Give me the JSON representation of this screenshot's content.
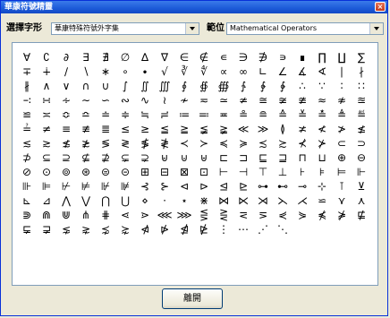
{
  "window": {
    "title": "華康符號精靈",
    "close_glyph": "×"
  },
  "toolbar": {
    "font_label": "選擇字形",
    "font_value": "華康特殊符號外字集",
    "location_label": "範位",
    "location_value": "Mathematical Operators"
  },
  "grid": {
    "rows": [
      [
        "∀",
        "∁",
        "∂",
        "∃",
        "∄",
        "∅",
        "∆",
        "∇",
        "∈",
        "∉",
        "∊",
        "∋",
        "∌",
        "∍",
        "∎",
        "∏",
        "∐",
        "∑",
        "−"
      ],
      [
        "∓",
        "∔",
        "∕",
        "∖",
        "∗",
        "∘",
        "∙",
        "√",
        "∛",
        "∜",
        "∝",
        "∞",
        "∟",
        "∠",
        "∡",
        "∢",
        "∣",
        "∤",
        "∥"
      ],
      [
        "∦",
        "∧",
        "∨",
        "∩",
        "∪",
        "∫",
        "∬",
        "∭",
        "∮",
        "∯",
        "∰",
        "∱",
        "∲",
        "∳",
        "∴",
        "∵",
        "∶",
        "∷",
        "∸"
      ],
      [
        "∹",
        "∺",
        "∻",
        "∼",
        "∽",
        "∾",
        "∿",
        "≀",
        "≁",
        "≂",
        "≃",
        "≄",
        "≅",
        "≆",
        "≇",
        "≈",
        "≉",
        "≊",
        "≋"
      ],
      [
        "≌",
        "≍",
        "≎",
        "≏",
        "≐",
        "≑",
        "≒",
        "≓",
        "≔",
        "≕",
        "≖",
        "≗",
        "≘",
        "≙",
        "≚",
        "≛",
        "≜",
        "≝",
        "≞"
      ],
      [
        "≟",
        "≠",
        "≡",
        "≢",
        "≣",
        "≤",
        "≥",
        "≦",
        "≧",
        "≨",
        "≩",
        "≪",
        "≫",
        "≬",
        "≭",
        "≮",
        "≯",
        "≰"
      ],
      [
        "≲",
        "≳",
        "≴",
        "≵",
        "≶",
        "≷",
        "≸",
        "≹",
        "≺",
        "≻",
        "≼",
        "≽",
        "≾",
        "≿",
        "⊀",
        "⊁",
        "⊂",
        "⊃",
        "⊄"
      ],
      [
        "⊅",
        "⊆",
        "⊇",
        "⊈",
        "⊉",
        "⊊",
        "⊋",
        "⊌",
        "⊍",
        "⊎",
        "⊏",
        "⊐",
        "⊑",
        "⊒",
        "⊓",
        "⊔",
        "⊕",
        "⊖",
        "⊗"
      ],
      [
        "⊘",
        "⊙",
        "⊚",
        "⊛",
        "⊜",
        "⊝",
        "⊞",
        "⊟",
        "⊠",
        "⊡",
        "⊢",
        "⊣",
        "⊤",
        "⊥",
        "⊦",
        "⊧",
        "⊨",
        "⊩"
      ],
      [
        "⊪",
        "⊫",
        "⊬",
        "⊭",
        "⊮",
        "⊯",
        "⊰",
        "⊱",
        "⊲",
        "⊳",
        "⊴",
        "⊵",
        "⊶",
        "⊷",
        "⊸",
        "⊹",
        "⊺",
        "⊻",
        "⊼",
        "⊽"
      ],
      [
        "⊾",
        "⊿",
        "⋀",
        "⋁",
        "⋂",
        "⋃",
        "⋄",
        "⋅",
        "⋆",
        "⋇",
        "⋈",
        "⋉",
        "⋊",
        "⋋",
        "⋌",
        "⋍",
        "⋎",
        "⋏",
        "⋐"
      ],
      [
        "⋑",
        "⋒",
        "⋓",
        "⋔",
        "⋕",
        "⋖",
        "⋗",
        "⋘",
        "⋙",
        "⋚",
        "⋛",
        "⋜",
        "⋝",
        "⋞",
        "⋟",
        "⋠",
        "⋡",
        "⋢",
        "⋣"
      ],
      [
        "⋤",
        "⋥",
        "⋦",
        "⋧",
        "⋨",
        "⋩",
        "⋪",
        "⋫",
        "⋬",
        "⋭",
        "⋮",
        "⋯",
        "⋰",
        "⋱"
      ]
    ]
  },
  "footer": {
    "close_label": "離開"
  }
}
